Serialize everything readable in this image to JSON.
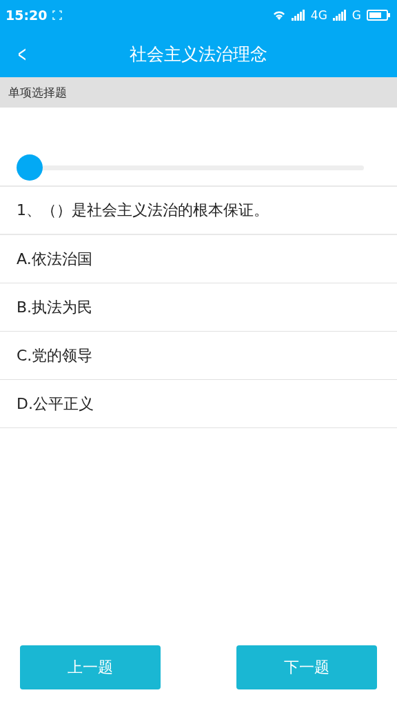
{
  "status_bar": {
    "time": "15:20",
    "network_1": "4G",
    "network_2": "G"
  },
  "header": {
    "back": "<",
    "title": "社会主义法治理念"
  },
  "section": {
    "label": "单项选择题"
  },
  "progress": {
    "level": 0
  },
  "question": {
    "text": "1、（）是社会主义法治的根本保证。"
  },
  "options": [
    {
      "label": "A.依法治国",
      "selected": false
    },
    {
      "label": "B.执法为民",
      "selected": false
    },
    {
      "label": "C.党的领导",
      "selected": false
    },
    {
      "label": "D.公平正义",
      "selected": false
    }
  ],
  "buttons": [
    {
      "label": "上一题"
    },
    {
      "label": "下一题"
    }
  ]
}
